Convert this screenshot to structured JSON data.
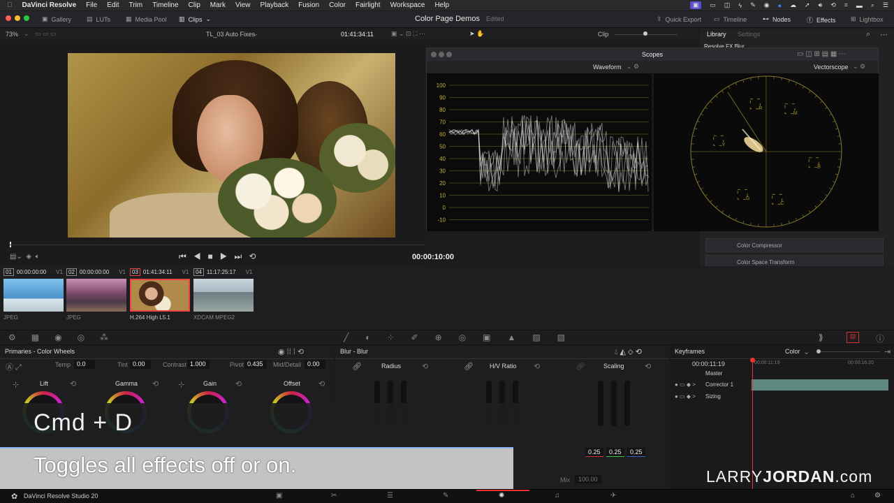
{
  "menubar": {
    "app": "DaVinci Resolve",
    "items": [
      "File",
      "Edit",
      "Trim",
      "Timeline",
      "Clip",
      "Mark",
      "View",
      "Playback",
      "Fusion",
      "Color",
      "Fairlight",
      "Workspace",
      "Help"
    ]
  },
  "toolbar": {
    "gallery": "Gallery",
    "luts": "LUTs",
    "media_pool": "Media Pool",
    "clips": "Clips",
    "project_title": "Color Page Demos",
    "edited": "Edited",
    "quick_export": "Quick Export",
    "timeline": "Timeline",
    "nodes": "Nodes",
    "effects": "Effects",
    "lightbox": "Lightbox"
  },
  "viewerbar": {
    "zoom": "73%",
    "timeline_name": "TL_03 Auto Fixes",
    "timecode": "01:41:34:11",
    "clip_mode": "Clip",
    "library_tab": "Library",
    "settings_tab": "Settings",
    "library_header": "Resolve FX Blur"
  },
  "viewer": {
    "duration": "00:00:10:00"
  },
  "scopes": {
    "title": "Scopes",
    "left_scope": "Waveform",
    "right_scope": "Vectorscope",
    "wave_labels": [
      "100",
      "90",
      "80",
      "70",
      "60",
      "50",
      "40",
      "30",
      "20",
      "10",
      "0",
      "-10"
    ],
    "vector_targets": [
      "R",
      "M",
      "B",
      "C",
      "G",
      "Y"
    ]
  },
  "library": {
    "items": [
      "Color Compressor",
      "Color Space Transform"
    ]
  },
  "clips": [
    {
      "num": "01",
      "tc": "00:00:00:00",
      "track": "V1",
      "codec": "JPEG",
      "color": "#5aa0d8"
    },
    {
      "num": "02",
      "tc": "00:00:00:00",
      "track": "V1",
      "codec": "JPEG",
      "color": "#7a4a6a"
    },
    {
      "num": "03",
      "tc": "01:41:34:11",
      "track": "V1",
      "codec": "H.264 High L5.1",
      "color": "#b89060"
    },
    {
      "num": "04",
      "tc": "11:17:25:17",
      "track": "V1",
      "codec": "XDCAM MPEG2",
      "color": "#8fa6b0"
    }
  ],
  "primaries": {
    "title": "Primaries - Color Wheels",
    "temp_label": "Temp",
    "temp_val": "0.0",
    "tint_label": "Tint",
    "tint_val": "0.00",
    "contrast_label": "Contrast",
    "contrast_val": "1.000",
    "pivot_label": "Pivot",
    "pivot_val": "0.435",
    "middetail_label": "Mid/Detail",
    "middetail_val": "0.00",
    "wheels": [
      "Lift",
      "Gamma",
      "Gain",
      "Offset"
    ]
  },
  "blur": {
    "title": "Blur - Blur",
    "radius": "Radius",
    "hv_ratio": "H/V Ratio",
    "scaling": "Scaling",
    "scaling_vals": [
      "0.25",
      "0.25",
      "0.25"
    ],
    "mix_label": "Mix",
    "mix_val": "100.00"
  },
  "keyframes": {
    "title": "Keyframes",
    "mode": "Color",
    "timecode": "00:00:11:19",
    "ruler_start": "00:00:11:19",
    "ruler_end": "00:00:16:20",
    "master": "Master",
    "tracks": [
      "Corrector 1",
      "Sizing"
    ]
  },
  "overlay": {
    "shortcut": "Cmd + D",
    "caption": "Toggles all effects off or on.",
    "brand_light": "LARRY",
    "brand_bold": "JORDAN",
    "brand_suffix": ".com"
  },
  "footer": {
    "app_version": "DaVinci Resolve Studio 20"
  }
}
